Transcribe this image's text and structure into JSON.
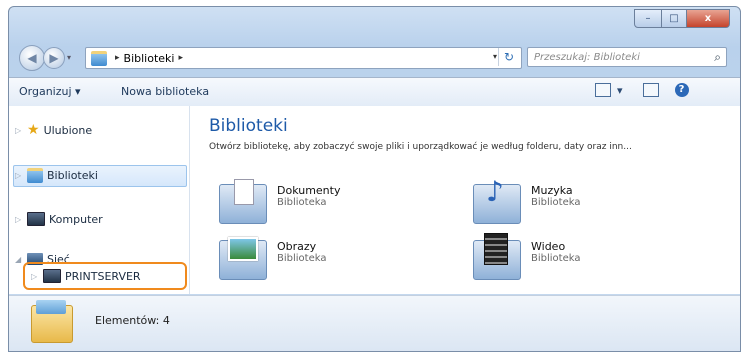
{
  "caption": {
    "min": "–",
    "max": "□",
    "close": "x"
  },
  "address": {
    "crumb": "Biblioteki",
    "sep": "▸",
    "dropdown": "▾",
    "refresh": "↻"
  },
  "search": {
    "placeholder": "Przeszukaj: Biblioteki"
  },
  "toolbar": {
    "organize": "Organizuj ▾",
    "new_library": "Nowa biblioteka",
    "views_arrow": "▾",
    "help": "?"
  },
  "nav": {
    "favorites": "Ulubione",
    "libraries": "Biblioteki",
    "computer": "Komputer",
    "network": "Sieć",
    "printserver": "PRINTSERVER"
  },
  "main": {
    "title": "Biblioteki",
    "description": "Otwórz bibliotekę, aby zobaczyć swoje pliki i uporządkować je według folderu, daty oraz inn...",
    "items": [
      {
        "name": "Dokumenty",
        "type": "Biblioteka"
      },
      {
        "name": "Muzyka",
        "type": "Biblioteka"
      },
      {
        "name": "Obrazy",
        "type": "Biblioteka"
      },
      {
        "name": "Wideo",
        "type": "Biblioteka"
      }
    ]
  },
  "status": {
    "count": "Elementów: 4"
  }
}
